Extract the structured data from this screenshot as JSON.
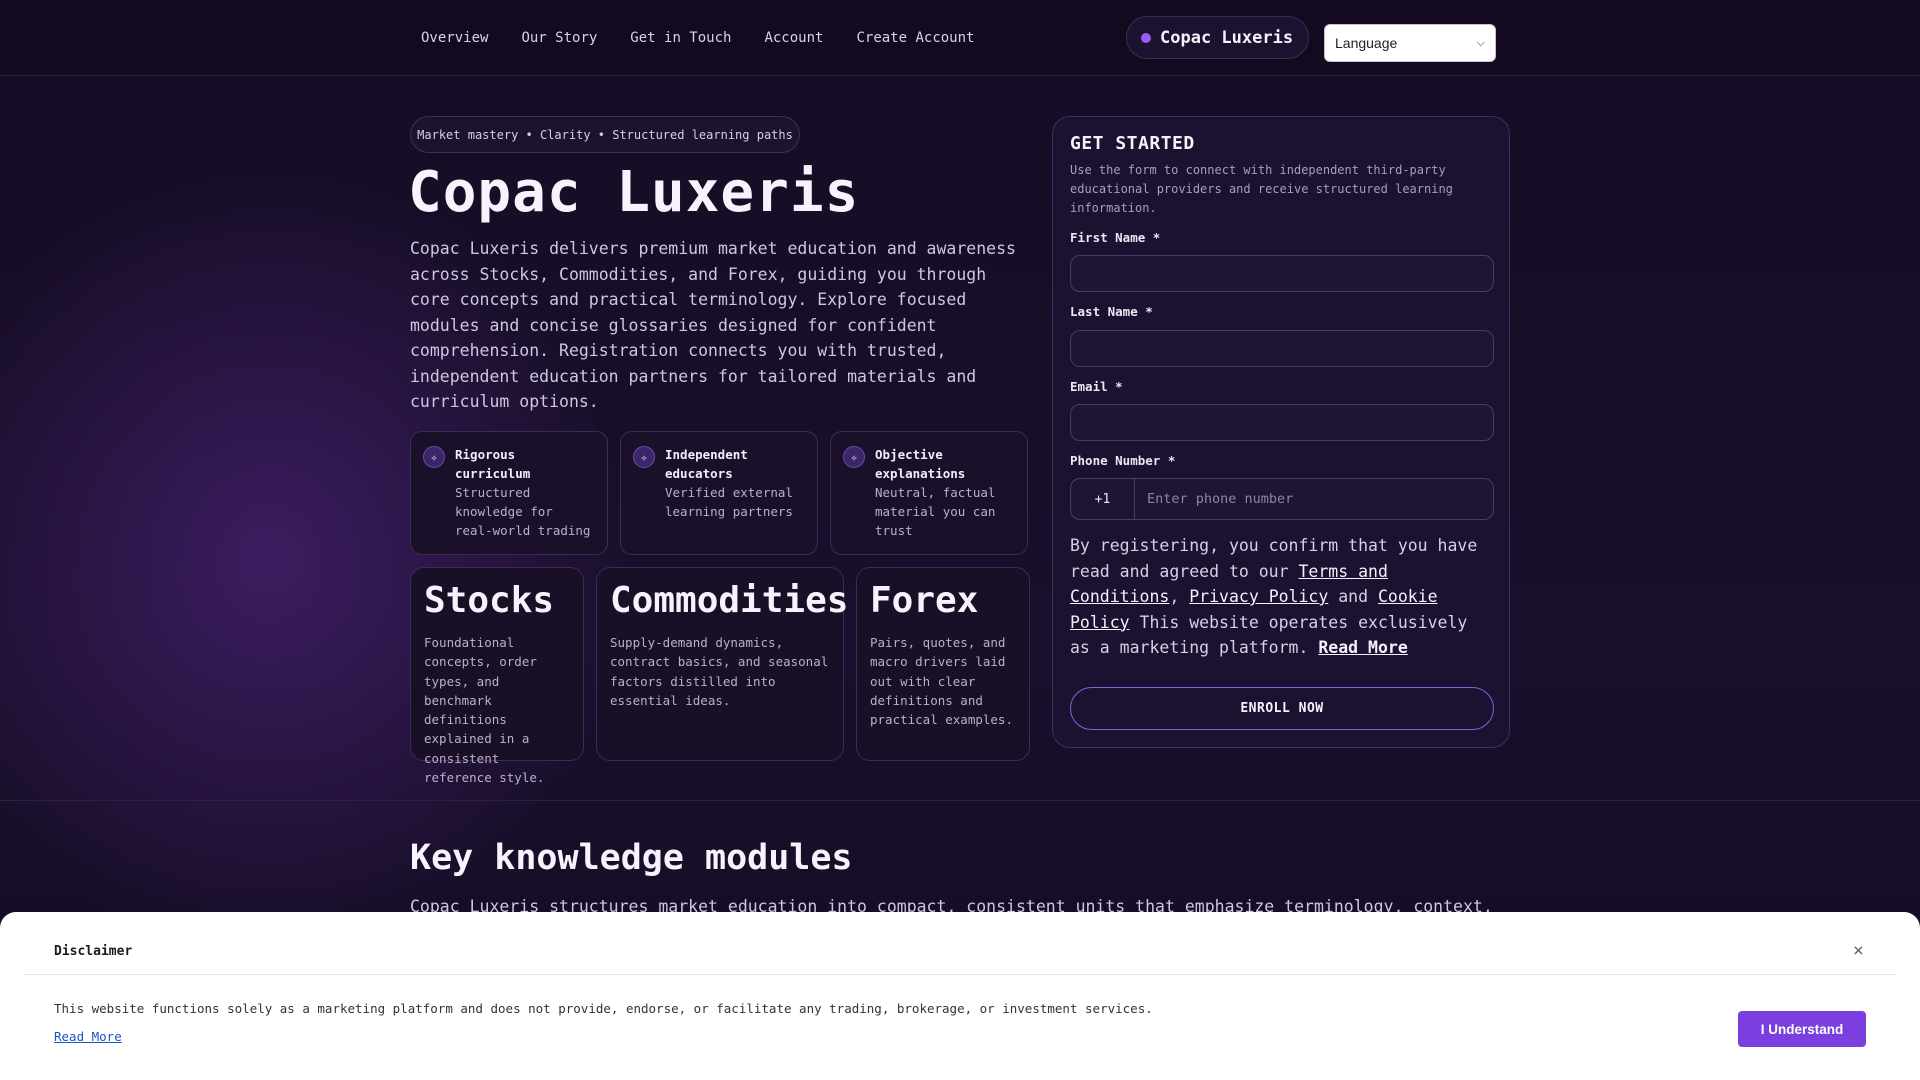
{
  "nav": {
    "links": [
      "Overview",
      "Our Story",
      "Get in Touch",
      "Account",
      "Create Account"
    ],
    "brand": "Copac Luxeris",
    "language_label": "Language"
  },
  "hero": {
    "tagline": "Market mastery • Clarity • Structured learning paths",
    "title": "Copac Luxeris",
    "description": "Copac Luxeris delivers premium market education and awareness across Stocks, Commodities, and Forex, guiding you through core concepts and practical terminology. Explore focused modules and concise glossaries designed for confident comprehension. Registration connects you with trusted, independent education partners for tailored materials and curriculum options.",
    "features": [
      {
        "icon": "sparkle-icon",
        "title": "Rigorous curriculum",
        "desc": "Structured knowledge for real-world trading"
      },
      {
        "icon": "sparkle-icon",
        "title": "Independent educators",
        "desc": "Verified external learning partners"
      },
      {
        "icon": "sparkle-icon",
        "title": "Objective explanations",
        "desc": "Neutral, factual material you can trust"
      }
    ],
    "markets": [
      {
        "title": "Stocks",
        "desc": "Foundational concepts, order types, and benchmark definitions explained in a consistent reference style."
      },
      {
        "title": "Commodities",
        "desc": "Supply-demand dynamics, contract basics, and seasonal factors distilled into essential ideas."
      },
      {
        "title": "Forex",
        "desc": "Pairs, quotes, and macro drivers laid out with clear definitions and practical examples."
      }
    ]
  },
  "form": {
    "title": "GET STARTED",
    "subtitle": "Use the form to connect with independent third-party educational providers and receive structured learning information.",
    "first_name_label": "First Name *",
    "last_name_label": "Last Name *",
    "email_label": "Email *",
    "phone_label": "Phone Number *",
    "country_code": "+1",
    "phone_placeholder": "Enter phone number",
    "consent_prefix": "By registering, you confirm that you have read and agreed to our ",
    "terms_link": "Terms and Conditions",
    "comma": ", ",
    "privacy_link": "Privacy Policy",
    "and": " and ",
    "cookie_link": "Cookie Policy",
    "consent_suffix": " This website operates exclusively as a marketing platform. ",
    "read_more": "Read More",
    "submit": "ENROLL NOW"
  },
  "modules": {
    "title": "Key knowledge modules",
    "desc": "Copac Luxeris structures market education into compact, consistent units that emphasize terminology, context,"
  },
  "disclaimer": {
    "title": "Disclaimer",
    "close": "×",
    "text": "This website functions solely as a marketing platform and does not provide, endorse, or facilitate any trading, brokerage, or investment services.",
    "read_more": "Read More",
    "button": "I Understand"
  },
  "colors": {
    "background": "#140b22",
    "accent": "#7b3fe0",
    "card_border": "#3a2d52"
  }
}
